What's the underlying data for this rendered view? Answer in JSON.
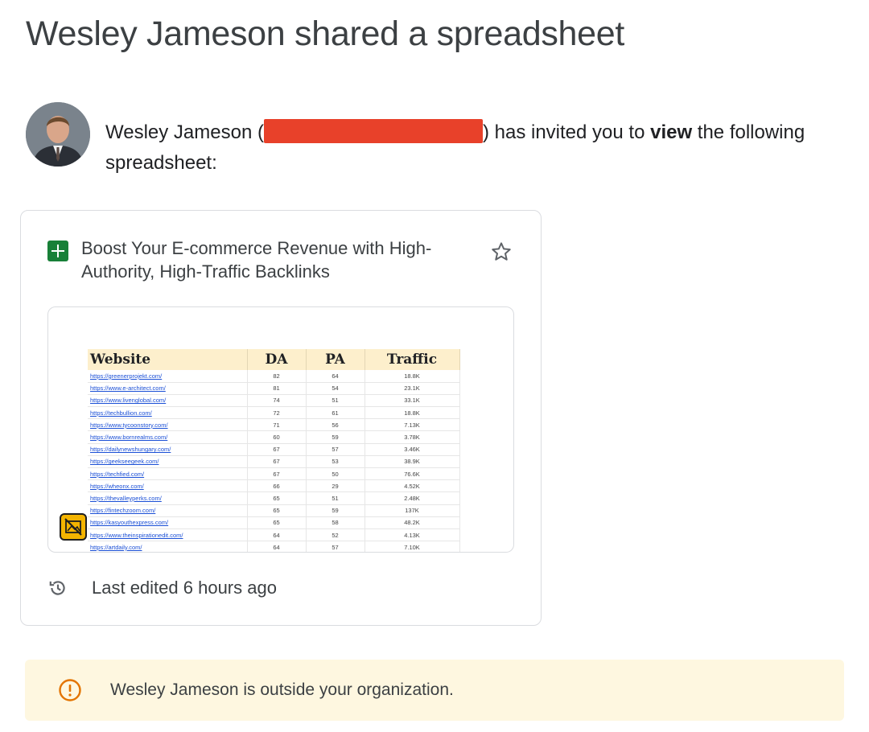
{
  "header": {
    "title": "Wesley Jameson shared a spreadsheet"
  },
  "invite": {
    "sender_name": "Wesley Jameson (",
    "mid_text": ") has invited you to ",
    "permission": "view",
    "end_text": " the following spreadsheet:"
  },
  "card": {
    "doc_title": "Boost Your E-commerce Revenue with High-Authority, High-Traffic Backlinks",
    "last_edited": "Last edited 6 hours ago",
    "preview": {
      "columns": [
        "Website",
        "DA",
        "PA",
        "Traffic"
      ],
      "rows": [
        [
          "https://greenerprojekt.com/",
          "82",
          "64",
          "18.8K"
        ],
        [
          "https://www.e-architect.com/",
          "81",
          "54",
          "23.1K"
        ],
        [
          "https://www.livenglobal.com/",
          "74",
          "51",
          "33.1K"
        ],
        [
          "https://techbullion.com/",
          "72",
          "61",
          "18.8K"
        ],
        [
          "https://www.tycoonstory.com/",
          "71",
          "56",
          "7.13K"
        ],
        [
          "https://www.bornrealms.com/",
          "60",
          "59",
          "3.78K"
        ],
        [
          "https://dailynewshungary.com/",
          "67",
          "57",
          "3.46K"
        ],
        [
          "https://geekseegeek.com/",
          "67",
          "53",
          "38.9K"
        ],
        [
          "https://techfied.com/",
          "67",
          "50",
          "76.6K"
        ],
        [
          "https://wheonx.com/",
          "66",
          "29",
          "4.52K"
        ],
        [
          "https://thevalleyperks.com/",
          "65",
          "51",
          "2.48K"
        ],
        [
          "https://fintechzoom.com/",
          "65",
          "59",
          "137K"
        ],
        [
          "https://kasyouthexpress.com/",
          "65",
          "58",
          "48.2K"
        ],
        [
          "https://www.theinspirationedit.com/",
          "64",
          "52",
          "4.13K"
        ],
        [
          "https://artdaily.com/",
          "64",
          "57",
          "7.10K"
        ]
      ]
    }
  },
  "banner": {
    "text": "Wesley Jameson is outside your organization."
  },
  "colors": {
    "sheets_green": "#188038",
    "redaction": "#e8412a",
    "banner_bg": "#fef7e0",
    "warning": "#e37400"
  }
}
